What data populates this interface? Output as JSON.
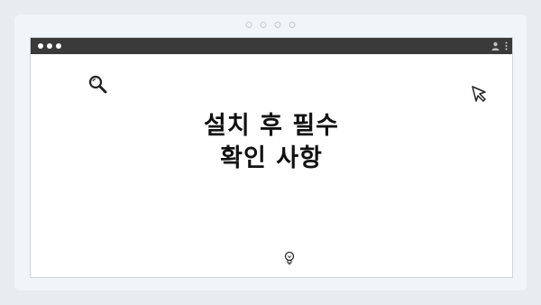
{
  "window": {
    "controls": [
      "close",
      "minimize",
      "maximize"
    ],
    "toolbar_icons": [
      "profile-icon",
      "kebab-menu-icon"
    ]
  },
  "content": {
    "title_line1": "설치 후 필수",
    "title_line2": "확인 사항",
    "icons": [
      "search-icon",
      "cursor-icon",
      "lightbulb-icon"
    ]
  },
  "colors": {
    "page_background": "#e8ecf1",
    "titlebar": "#3a3a3a",
    "window_background": "#ffffff",
    "text": "#111111"
  }
}
